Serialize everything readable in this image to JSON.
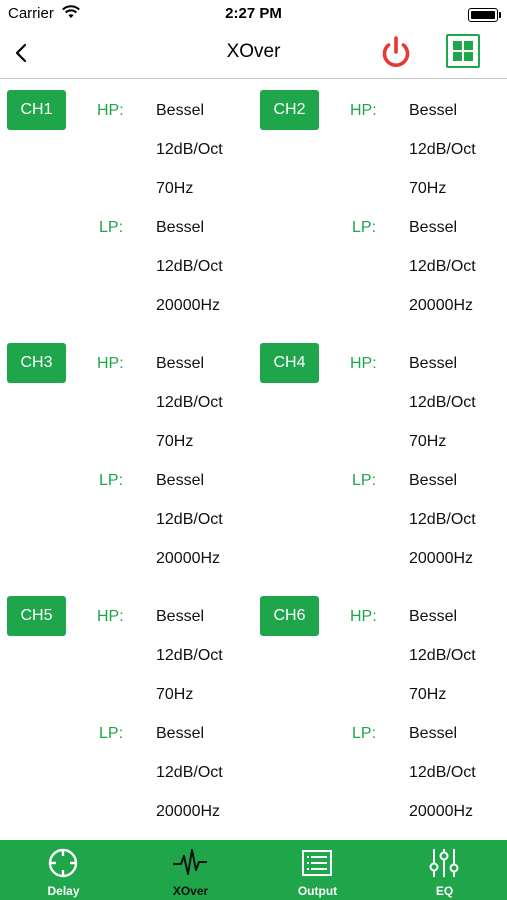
{
  "status": {
    "carrier": "Carrier",
    "time": "2:27 PM"
  },
  "header": {
    "title": "XOver",
    "back_icon": "chevron-left-icon",
    "power_icon": "power-icon",
    "layout_icon": "grid-layout-icon",
    "power_color": "#e53935",
    "accent_color": "#1fa64a"
  },
  "channels": [
    {
      "name": "CH1",
      "hp_label": "HP:",
      "hp_type": "Bessel",
      "hp_slope": "12dB/Oct",
      "hp_freq": "70Hz",
      "lp_label": "LP:",
      "lp_type": "Bessel",
      "lp_slope": "12dB/Oct",
      "lp_freq": "20000Hz"
    },
    {
      "name": "CH2",
      "hp_label": "HP:",
      "hp_type": "Bessel",
      "hp_slope": "12dB/Oct",
      "hp_freq": "70Hz",
      "lp_label": "LP:",
      "lp_type": "Bessel",
      "lp_slope": "12dB/Oct",
      "lp_freq": "20000Hz"
    },
    {
      "name": "CH3",
      "hp_label": "HP:",
      "hp_type": "Bessel",
      "hp_slope": "12dB/Oct",
      "hp_freq": "70Hz",
      "lp_label": "LP:",
      "lp_type": "Bessel",
      "lp_slope": "12dB/Oct",
      "lp_freq": "20000Hz"
    },
    {
      "name": "CH4",
      "hp_label": "HP:",
      "hp_type": "Bessel",
      "hp_slope": "12dB/Oct",
      "hp_freq": "70Hz",
      "lp_label": "LP:",
      "lp_type": "Bessel",
      "lp_slope": "12dB/Oct",
      "lp_freq": "20000Hz"
    },
    {
      "name": "CH5",
      "hp_label": "HP:",
      "hp_type": "Bessel",
      "hp_slope": "12dB/Oct",
      "hp_freq": "70Hz",
      "lp_label": "LP:",
      "lp_type": "Bessel",
      "lp_slope": "12dB/Oct",
      "lp_freq": "20000Hz"
    },
    {
      "name": "CH6",
      "hp_label": "HP:",
      "hp_type": "Bessel",
      "hp_slope": "12dB/Oct",
      "hp_freq": "70Hz",
      "lp_label": "LP:",
      "lp_type": "Bessel",
      "lp_slope": "12dB/Oct",
      "lp_freq": "20000Hz"
    }
  ],
  "tabs": [
    {
      "label": "Delay",
      "icon": "target-icon",
      "active": false
    },
    {
      "label": "XOver",
      "icon": "waveform-icon",
      "active": true
    },
    {
      "label": "Output",
      "icon": "list-icon",
      "active": false
    },
    {
      "label": "EQ",
      "icon": "sliders-icon",
      "active": false
    }
  ]
}
